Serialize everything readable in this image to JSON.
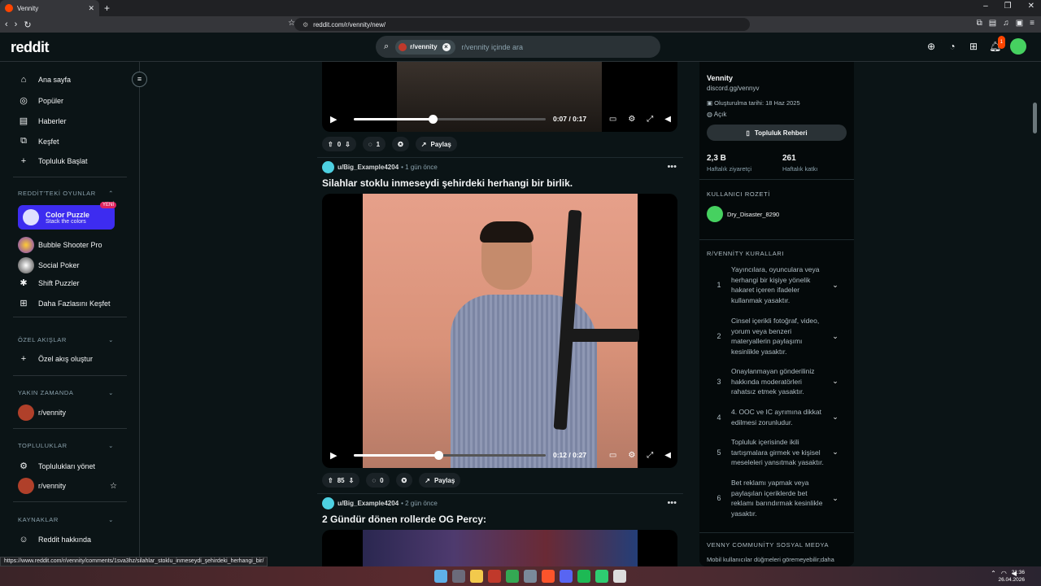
{
  "browser": {
    "tab_title": "Vennity",
    "url": "reddit.com/r/vennity/new/",
    "status_url": "https://www.reddit.com/r/vennity/comments/1sva3hz/silahlar_stoklu_inmeseydi_şehirdeki_herhangi_bir/"
  },
  "header": {
    "logo": "reddit",
    "search_chip": "r/vennity",
    "search_placeholder": "r/vennity içinde ara",
    "notification_count": "1"
  },
  "sidebar": {
    "nav": [
      {
        "label": "Ana sayfa",
        "icon": "home-icon"
      },
      {
        "label": "Popüler",
        "icon": "popular-icon"
      },
      {
        "label": "Haberler",
        "icon": "news-icon"
      },
      {
        "label": "Keşfet",
        "icon": "explore-icon"
      },
      {
        "label": "Topluluk Başlat",
        "icon": "plus-icon"
      }
    ],
    "games_header": "REDDİT'TEKİ OYUNLAR",
    "promo": {
      "title": "Color Puzzle",
      "subtitle": "Stack the colors",
      "badge": "YENİ"
    },
    "games": [
      "Bubble Shooter Pro",
      "Social Poker",
      "Shift Puzzler",
      "Daha Fazlasını Keşfet"
    ],
    "custom_feeds_header": "ÖZEL AKIŞLAR",
    "custom_feed_create": "Özel akış oluştur",
    "recent_header": "YAKIN ZAMANDA",
    "recent_item": "r/vennity",
    "communities_header": "TOPLULUKLAR",
    "manage_communities": "Toplulukları yönet",
    "community_item": "r/vennity",
    "resources_header": "KAYNAKLAR",
    "about_reddit": "Reddit hakkında"
  },
  "feed": {
    "post0": {
      "time": "0:07 / 0:17",
      "progress": 0.41,
      "votes": "0",
      "comments": "1",
      "share": "Paylaş"
    },
    "post1": {
      "user": "u/Big_Example4204",
      "age": "• 1 gün önce",
      "title": "Silahlar stoklu inmeseydi şehirdeki herhangi bir birlik.",
      "time": "0:12 / 0:27",
      "progress": 0.44,
      "votes": "85",
      "comments": "0",
      "share": "Paylaş"
    },
    "post2": {
      "user": "u/Big_Example4204",
      "age": "• 2 gün önce",
      "title": "2 Gündür dönen rollerde OG Percy:"
    }
  },
  "community": {
    "name": "Vennity",
    "link": "discord.gg/vennyv",
    "created": "Oluşturulma tarihi: 18 Haz 2025",
    "visibility": "Açık",
    "guide_button": "Topluluk Rehberi",
    "stats": [
      {
        "value": "2,3 B",
        "label": "Haftalık ziyaretçi"
      },
      {
        "value": "261",
        "label": "Haftalık katkı"
      }
    ],
    "badge_header": "KULLANICI ROZETİ",
    "badge_user": "Dry_Disaster_8290",
    "rules_header": "R/VENNİTY KURALLARI",
    "rules": [
      {
        "num": "1",
        "text": "Yayıncılara, oyunculara veya herhangi bir kişiye yönelik hakaret içeren ifadeler kullanmak yasaktır."
      },
      {
        "num": "2",
        "text": "Cinsel içerikli fotoğraf, video, yorum veya benzeri materyallerin paylaşımı kesinlikle yasaktır."
      },
      {
        "num": "3",
        "text": "Onaylanmayan gönderiliniz hakkında moderatörleri rahatsız etmek yasaktır."
      },
      {
        "num": "4",
        "text": "4. OOC ve IC ayrımına dikkat edilmesi zorunludur."
      },
      {
        "num": "5",
        "text": "Topluluk içerisinde ikili tartışmalara girmek ve kişisel meseleleri yansıtmak yasaktır."
      },
      {
        "num": "6",
        "text": "Bet reklamı yapmak veya paylaşılan içeriklerde bet reklamı barındırmak kesinlikle yasaktır."
      }
    ],
    "social_header": "VENNY COMMUNİTY SOSYAL MEDYA",
    "social_note": "Mobil kullanıcılar düğmeleri göremeyebilir;daha"
  },
  "taskbar": {
    "time": "21:36",
    "date": "26.04.2026"
  }
}
